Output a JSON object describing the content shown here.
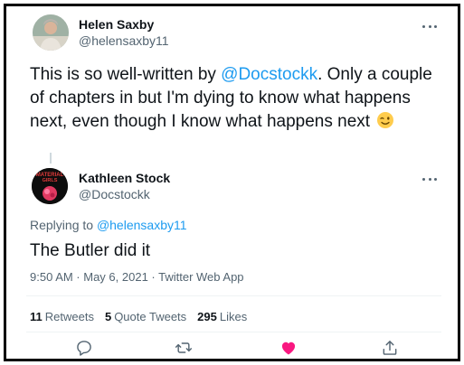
{
  "parent_tweet": {
    "author_name": "Helen Saxby",
    "author_handle": "@helensaxby11",
    "text_before_mention": "This is so well-written by ",
    "mention": "@Docstockk",
    "text_after_mention": ". Only a couple of chapters in but I'm dying to know what happens next, even though I know what happens next",
    "emoji": "winking-face"
  },
  "main_tweet": {
    "author_name": "Kathleen Stock",
    "author_handle": "@Docstockk",
    "avatar_text": "MATERIAL GIRLS",
    "replying_to_label": "Replying to",
    "replying_to_handle": "@helensaxby11",
    "text": "The Butler did it",
    "timestamp": "9:50 AM · May 6, 2021 · Twitter Web App"
  },
  "stats": {
    "retweets_count": "11",
    "retweets_label": "Retweets",
    "quotes_count": "5",
    "quotes_label": "Quote Tweets",
    "likes_count": "295",
    "likes_label": "Likes"
  },
  "actions": {
    "reply_icon": "reply-icon",
    "retweet_icon": "retweet-icon",
    "like_icon": "heart-icon",
    "share_icon": "share-icon"
  },
  "colors": {
    "link": "#1d9bf0",
    "like_active": "#f91880",
    "secondary_text": "#536471"
  }
}
